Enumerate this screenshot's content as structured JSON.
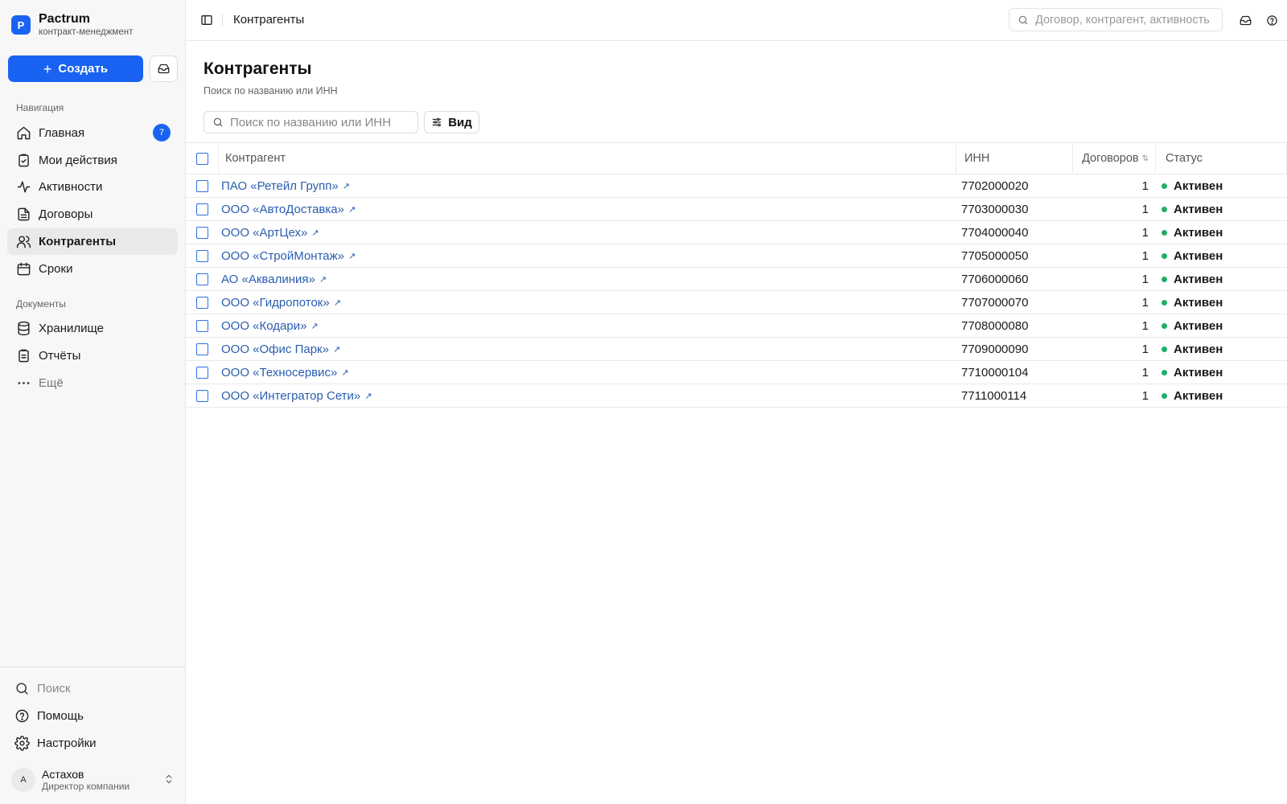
{
  "brand": {
    "logo_letter": "P",
    "name": "Pactrum",
    "subtitle": "контракт-менеджмент"
  },
  "sidebar": {
    "create_label": "Создать",
    "nav_section": "Навигация",
    "nav_items": [
      {
        "label": "Главная",
        "icon": "home-icon",
        "badge": "7"
      },
      {
        "label": "Мои действия",
        "icon": "clipboard-check-icon"
      },
      {
        "label": "Активности",
        "icon": "activity-icon"
      },
      {
        "label": "Договоры",
        "icon": "file-text-icon"
      },
      {
        "label": "Контрагенты",
        "icon": "users-icon",
        "active": true
      },
      {
        "label": "Сроки",
        "icon": "calendar-icon"
      }
    ],
    "docs_section": "Документы",
    "doc_items": [
      {
        "label": "Хранилище",
        "icon": "database-icon"
      },
      {
        "label": "Отчёты",
        "icon": "report-icon"
      },
      {
        "label": "Ещё",
        "icon": "more-icon"
      }
    ],
    "bottom_items": [
      {
        "label": "Поиск",
        "icon": "search-icon"
      },
      {
        "label": "Помощь",
        "icon": "help-icon"
      },
      {
        "label": "Настройки",
        "icon": "gear-icon"
      }
    ],
    "user": {
      "initial": "А",
      "name": "Астахов",
      "role": "Директор компании"
    }
  },
  "topbar": {
    "breadcrumb": "Контрагенты",
    "search_placeholder": "Договор, контрагент, активность"
  },
  "main": {
    "title": "Контрагенты",
    "subtitle": "Поиск по названию или ИНН",
    "search_placeholder": "Поиск по названию или ИНН",
    "view_label": "Вид",
    "columns": {
      "name": "Контрагент",
      "inn": "ИНН",
      "count": "Договоров",
      "status": "Статус"
    },
    "rows": [
      {
        "name": "ПАО «Ретейл Групп»",
        "inn": "7702000020",
        "count": "1",
        "status": "Активен"
      },
      {
        "name": "ООО «АвтоДоставка»",
        "inn": "7703000030",
        "count": "1",
        "status": "Активен"
      },
      {
        "name": "ООО «АртЦех»",
        "inn": "7704000040",
        "count": "1",
        "status": "Активен"
      },
      {
        "name": "ООО «СтройМонтаж»",
        "inn": "7705000050",
        "count": "1",
        "status": "Активен"
      },
      {
        "name": "АО «Аквалиния»",
        "inn": "7706000060",
        "count": "1",
        "status": "Активен"
      },
      {
        "name": "ООО «Гидропоток»",
        "inn": "7707000070",
        "count": "1",
        "status": "Активен"
      },
      {
        "name": "ООО «Кодари»",
        "inn": "7708000080",
        "count": "1",
        "status": "Активен"
      },
      {
        "name": "ООО «Офис Парк»",
        "inn": "7709000090",
        "count": "1",
        "status": "Активен"
      },
      {
        "name": "ООО «Техносервис»",
        "inn": "7710000104",
        "count": "1",
        "status": "Активен"
      },
      {
        "name": "ООО «Интегратор Сети»",
        "inn": "7711000114",
        "count": "1",
        "status": "Активен"
      }
    ]
  },
  "colors": {
    "accent": "#1a63f2",
    "link": "#2a5db0",
    "status_active": "#1fae6a"
  }
}
